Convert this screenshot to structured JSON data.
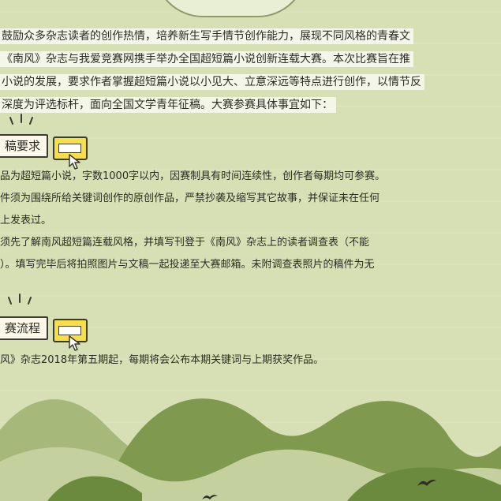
{
  "intro": {
    "lines": [
      "鼓励众多杂志读者的创作热情，培养新生写手情节创作能力，展现不同风格的青春文",
      "《南风》杂志与我爱竞赛网携手举办全国超短篇小说创新连载大赛。本次比赛旨在推",
      "小说的发展，要求作者掌握超短篇小说以小见大、立意深远等特点进行创作，以情节反",
      "深度为评选标杆，面向全国文学青年征稿。大赛参赛具体事宜如下："
    ]
  },
  "sections": {
    "requirements": {
      "label": "稿要求",
      "lines": [
        "品为超短篇小说，字数1000字以内，因赛制具有时间连续性，创作者每期均可参赛。",
        "件须为围绕所给关键词创作的原创作品，严禁抄袭及缩写其它故事，并保证未在任何",
        "上发表过。",
        "须先了解南风超短篇连载风格，并填写刊登于《南风》杂志上的读者调查表（不能",
        "）。填写完毕后将拍照图片与文稿一起投递至大赛邮箱。未附调查表照片的稿件为无"
      ]
    },
    "process": {
      "label": "赛流程",
      "lines": [
        "风》杂志2018年第五期起，每期将会公布本期关键词与上期获奖作品。"
      ]
    }
  },
  "colors": {
    "background": "#d6e0b4",
    "tag_yellow": "#f6df49",
    "hill_dark": "#7f9a4e",
    "hill_mid": "#a6b97a",
    "hill_light": "#c4d19f"
  },
  "icons": [
    "cursor-icon",
    "sparkle-icon",
    "bird-icon"
  ]
}
